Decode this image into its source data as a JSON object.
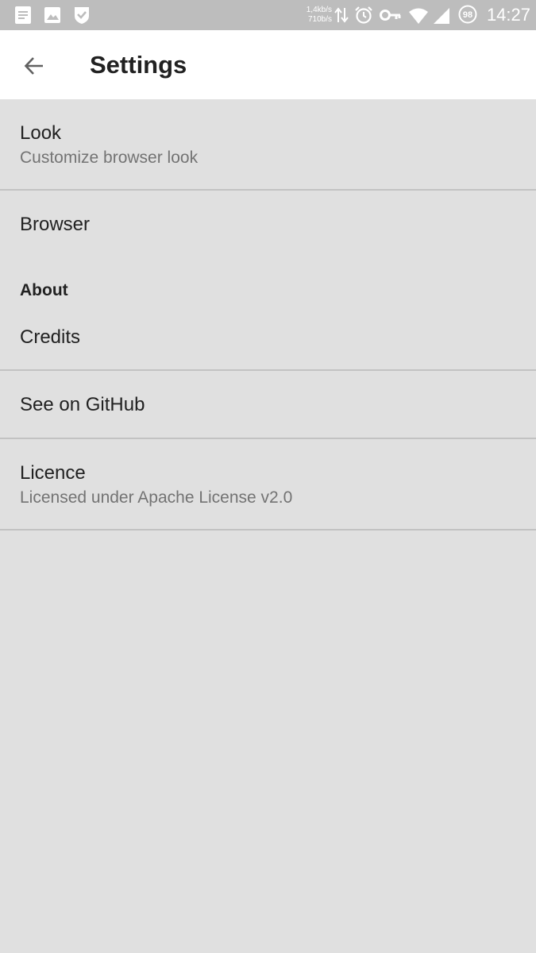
{
  "status_bar": {
    "icons": [
      "note-icon",
      "image-icon",
      "shield-check-icon",
      "data-transfer-icon",
      "alarm-icon",
      "vpn-key-icon",
      "wifi-icon",
      "cell-signal-icon",
      "battery-icon"
    ],
    "speed_up": "1,4kb/s",
    "speed_down": "710b/s",
    "battery_level": "98",
    "time": "14:27"
  },
  "app_bar": {
    "back_icon": "arrow-back-icon",
    "title": "Settings"
  },
  "preferences": {
    "look": {
      "title": "Look",
      "summary": "Customize browser look"
    },
    "browser": {
      "title": "Browser"
    },
    "about_category": "About",
    "credits": {
      "title": "Credits"
    },
    "github": {
      "title": "See on GitHub"
    },
    "licence": {
      "title": "Licence",
      "summary": "Licensed under Apache License v2.0"
    }
  },
  "colors": {
    "background": "#e0e0e0",
    "status_bar": "#bdbdbd",
    "app_bar": "#ffffff",
    "primary_text": "#212121",
    "secondary_text": "#737373",
    "divider": "#c2c2c2"
  }
}
